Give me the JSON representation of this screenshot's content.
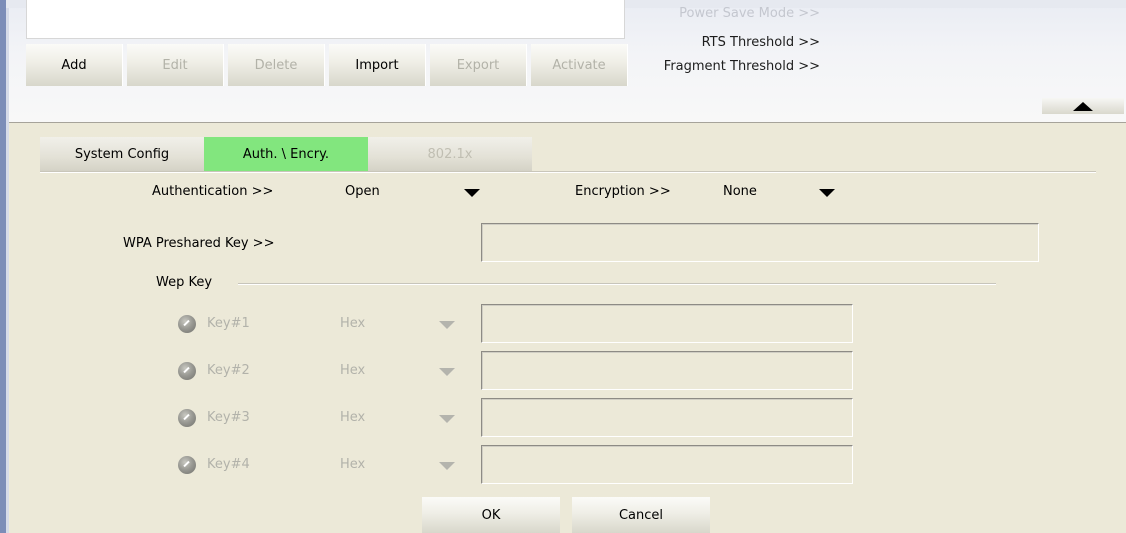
{
  "toolbar": {
    "add": "Add",
    "edit": "Edit",
    "delete": "Delete",
    "import": "Import",
    "export": "Export",
    "activate": "Activate"
  },
  "advanced": {
    "power_save": "Power Save Mode >>",
    "rts": "RTS Threshold >>",
    "fragment": "Fragment Threshold >>"
  },
  "tabs": {
    "system_config": "System Config",
    "auth_encry": "Auth. \\ Encry.",
    "dot1x": "802.1x"
  },
  "auth": {
    "authentication_label": "Authentication >>",
    "authentication_value": "Open",
    "encryption_label": "Encryption >>",
    "encryption_value": "None",
    "wpa_label": "WPA Preshared Key >>",
    "wpa_value": ""
  },
  "wep": {
    "group_label": "Wep Key",
    "keys": [
      {
        "label": "Key#1",
        "format": "Hex",
        "value": ""
      },
      {
        "label": "Key#2",
        "format": "Hex",
        "value": ""
      },
      {
        "label": "Key#3",
        "format": "Hex",
        "value": ""
      },
      {
        "label": "Key#4",
        "format": "Hex",
        "value": ""
      }
    ]
  },
  "dialog": {
    "ok": "OK",
    "cancel": "Cancel"
  }
}
